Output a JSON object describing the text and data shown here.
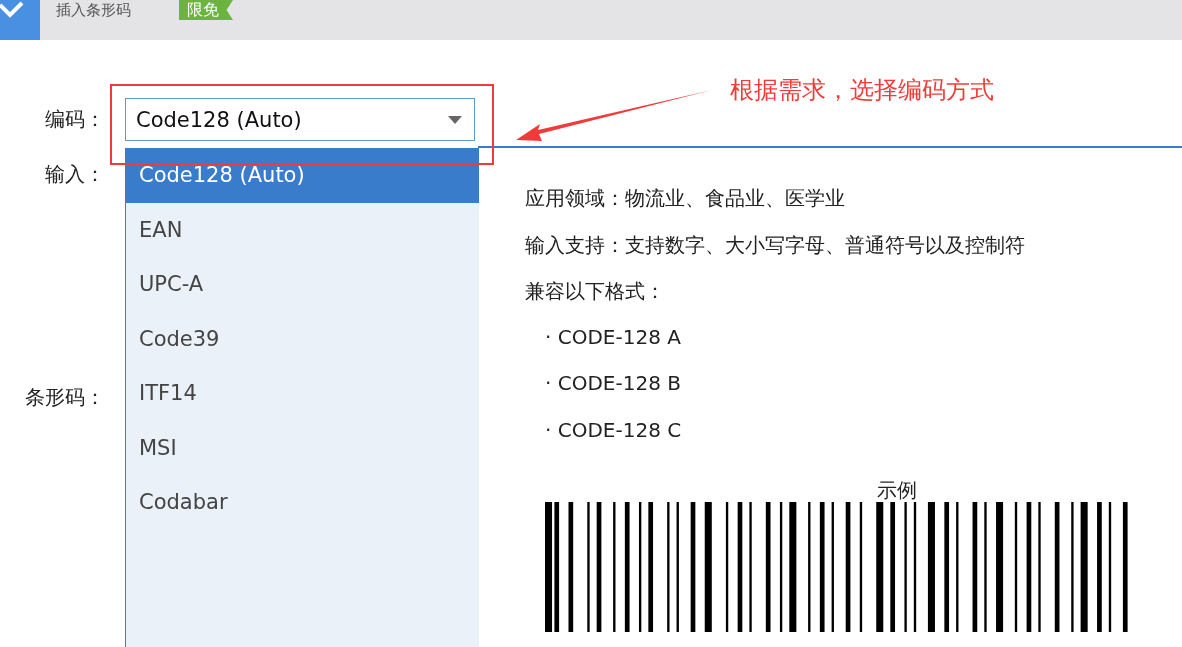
{
  "app_bar": {
    "title": "插入条形码",
    "badge": "限免"
  },
  "form": {
    "encoding_label": "编码：",
    "encoding_value": "Code128 (Auto)",
    "input_label": "输入：",
    "barcode_label": "条形码："
  },
  "dropdown": {
    "options": [
      {
        "label": "Code128 (Auto)",
        "selected": true
      },
      {
        "label": "EAN",
        "selected": false
      },
      {
        "label": "UPC-A",
        "selected": false
      },
      {
        "label": "Code39",
        "selected": false
      },
      {
        "label": "ITF14",
        "selected": false
      },
      {
        "label": "MSI",
        "selected": false
      },
      {
        "label": "Codabar",
        "selected": false
      }
    ]
  },
  "info": {
    "lines": [
      "应用领域：物流业、食品业、医学业",
      "输入支持：支持数字、大小写字母、普通符号以及控制符",
      "兼容以下格式："
    ],
    "formats": [
      "· CODE-128 A",
      "· CODE-128 B",
      "· CODE-128 C"
    ],
    "example_label": "示例"
  },
  "annotation": {
    "text": "根据需求，选择编码方式"
  }
}
